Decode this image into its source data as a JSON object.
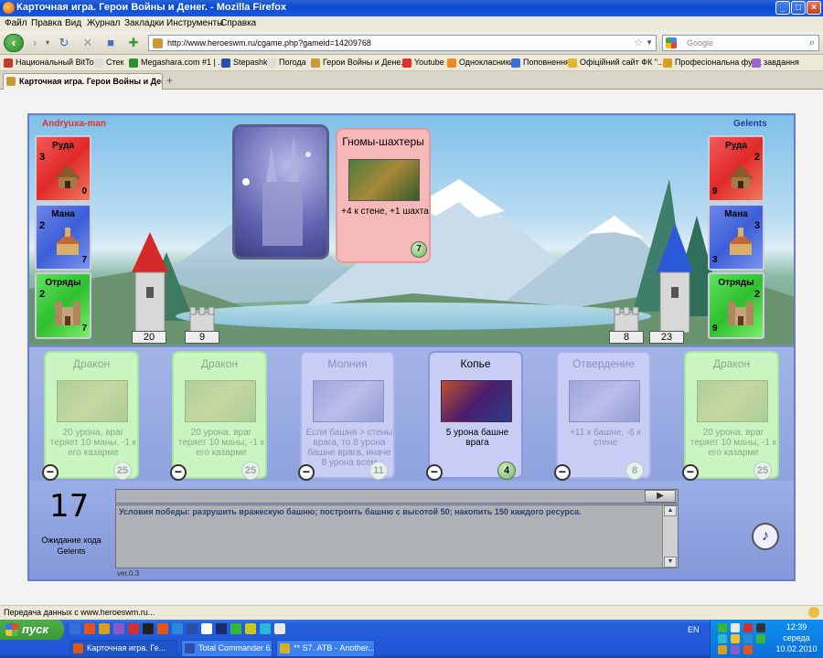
{
  "window": {
    "title": "Карточная игра. Герои Войны и Денег. - Mozilla Firefox"
  },
  "menu": [
    "Файл",
    "Правка",
    "Вид",
    "Журнал",
    "Закладки",
    "Инструменты",
    "Справка"
  ],
  "nav": {
    "url": "http://www.heroeswm.ru/cgame.php?gameid=14209768",
    "search_placeholder": "Google"
  },
  "bookmarks": [
    {
      "label": "Национальный BitTor...",
      "color": "#c0392b"
    },
    {
      "label": "Стек",
      "color": "#dddddd"
    },
    {
      "label": "Megashara.com #1 | ...",
      "color": "#2f8f2f"
    },
    {
      "label": "Stepashka",
      "color": "#2b4fa8"
    },
    {
      "label": "Погода",
      "color": "#dddddd"
    },
    {
      "label": "Герои Войны и Дене...",
      "color": "#c89a3a"
    },
    {
      "label": "Youtube",
      "color": "#e03030"
    },
    {
      "label": "Однокласники",
      "color": "#f08a1c"
    },
    {
      "label": "Поповнення",
      "color": "#3a6fd8"
    },
    {
      "label": "Офіційний сайт ФК \"...",
      "color": "#e2b82a"
    },
    {
      "label": "Професіональна фут...",
      "color": "#d8a020"
    },
    {
      "label": "завдання",
      "color": "#9a66cc"
    }
  ],
  "tab": {
    "label": "Карточная игра. Герои Войны и Ден..."
  },
  "game": {
    "player_left": {
      "name": "Andryuxa-man",
      "resources": [
        {
          "label": "Руда",
          "production": "3",
          "amount": "0"
        },
        {
          "label": "Мана",
          "production": "2",
          "amount": "7"
        },
        {
          "label": "Отряды",
          "production": "2",
          "amount": "7"
        }
      ],
      "tower": "20",
      "wall": "9"
    },
    "player_right": {
      "name": "Gelents",
      "resources": [
        {
          "label": "Руда",
          "production": "2",
          "amount": "9"
        },
        {
          "label": "Мана",
          "production": "3",
          "amount": "3"
        },
        {
          "label": "Отряды",
          "production": "2",
          "amount": "9"
        }
      ],
      "tower": "23",
      "wall": "8"
    },
    "played_card": {
      "title": "Гномы-шахтеры",
      "description": "+4 к стене, +1 шахта",
      "cost": "7"
    },
    "hand": [
      {
        "title": "Дракон",
        "description": "20 урона, враг теряет 10 маны, -1 к его казарме",
        "cost": "25",
        "active": false,
        "color": "green"
      },
      {
        "title": "Дракон",
        "description": "20 урона, враг теряет 10 маны, -1 к его казарме",
        "cost": "25",
        "active": false,
        "color": "green"
      },
      {
        "title": "Молния",
        "description": "Если башня > стены врага, то 8 урона башне врага, иначе 8 урона всем",
        "cost": "11",
        "active": false,
        "color": "blue"
      },
      {
        "title": "Копье",
        "description": "5 урона башне врага",
        "cost": "4",
        "active": true,
        "color": "blue"
      },
      {
        "title": "Отвердение",
        "description": "+11 к башне, -6 к стене",
        "cost": "8",
        "active": false,
        "color": "blue"
      },
      {
        "title": "Дракон",
        "description": "20 урона, враг теряет 10 маны, -1 к его казарме",
        "cost": "25",
        "active": false,
        "color": "green"
      }
    ],
    "turn_counter": "17",
    "waiting_text": "Ожидание хода Gelents",
    "log_text": "Условия победы: разрушить вражескую башню; построить башню с высотой 50; накопить 150 каждого ресурса.",
    "version": "ver.0.3"
  },
  "status": {
    "text": "Передача данных с www.heroeswm.ru..."
  },
  "taskbar": {
    "start": "пуск",
    "items": [
      {
        "label": "Карточная игра. Ге...",
        "color": "#e2561b"
      },
      {
        "label": "Total Commander 6.5...",
        "color": "#2d4fa8"
      },
      {
        "label": "** S7. АТВ - Another...",
        "color": "#d8b020"
      }
    ],
    "lang": "EN",
    "time": "12:39",
    "day": "середа",
    "date": "10.02.2010"
  }
}
